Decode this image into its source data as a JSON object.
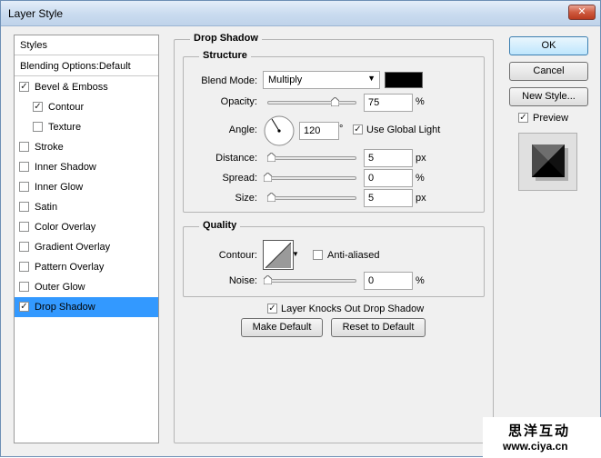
{
  "window": {
    "title": "Layer Style",
    "close_glyph": "✕"
  },
  "sidebar": {
    "header": "Styles",
    "blending": "Blending Options:Default",
    "items": [
      {
        "label": "Bevel & Emboss",
        "checked": true
      },
      {
        "label": "Contour",
        "checked": true
      },
      {
        "label": "Texture",
        "checked": false
      },
      {
        "label": "Stroke",
        "checked": false
      },
      {
        "label": "Inner Shadow",
        "checked": false
      },
      {
        "label": "Inner Glow",
        "checked": false
      },
      {
        "label": "Satin",
        "checked": false
      },
      {
        "label": "Color Overlay",
        "checked": false
      },
      {
        "label": "Gradient Overlay",
        "checked": false
      },
      {
        "label": "Pattern Overlay",
        "checked": false
      },
      {
        "label": "Outer Glow",
        "checked": false
      },
      {
        "label": "Drop Shadow",
        "checked": true,
        "selected": true
      }
    ]
  },
  "panel": {
    "title": "Drop Shadow",
    "structure": {
      "title": "Structure",
      "blend_mode_label": "Blend Mode:",
      "blend_mode_value": "Multiply",
      "shadow_color": "#000000",
      "opacity_label": "Opacity:",
      "opacity_value": "75",
      "opacity_unit": "%",
      "opacity_level": 0.75,
      "angle_label": "Angle:",
      "angle_value": "120",
      "angle_unit": "°",
      "use_global_light_label": "Use Global Light",
      "use_global_light": true,
      "distance_label": "Distance:",
      "distance_value": "5",
      "distance_unit": "px",
      "spread_label": "Spread:",
      "spread_value": "0",
      "spread_unit": "%",
      "size_label": "Size:",
      "size_value": "5",
      "size_unit": "px"
    },
    "quality": {
      "title": "Quality",
      "contour_label": "Contour:",
      "anti_aliased_label": "Anti-aliased",
      "anti_aliased": false,
      "noise_label": "Noise:",
      "noise_value": "0",
      "noise_unit": "%"
    },
    "knock_out_label": "Layer Knocks Out Drop Shadow",
    "knock_out": true,
    "make_default": "Make Default",
    "reset_default": "Reset to Default"
  },
  "actions": {
    "ok": "OK",
    "cancel": "Cancel",
    "new_style": "New Style...",
    "preview_label": "Preview",
    "preview": true
  },
  "watermark": {
    "line1": "思洋互动",
    "line2": "www.ciya.cn"
  }
}
